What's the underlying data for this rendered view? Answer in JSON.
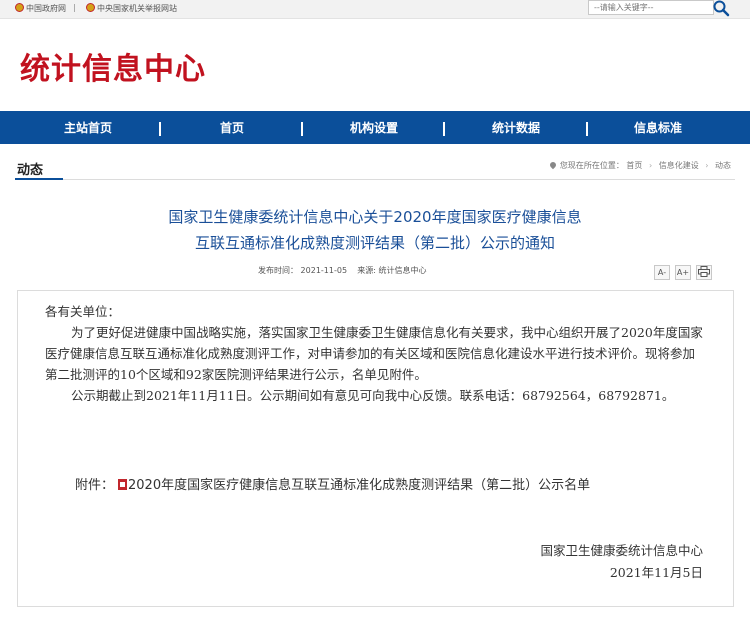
{
  "topbar": {
    "link1": "中国政府网",
    "sep": "|",
    "link2": "中央国家机关举报网站",
    "search_placeholder": "--请输入关键字--"
  },
  "site": {
    "title": "统计信息中心"
  },
  "nav": {
    "items": [
      "主站首页",
      "首页",
      "机构设置",
      "统计数据",
      "信息标准"
    ],
    "divider": "|"
  },
  "section": {
    "title": "动态"
  },
  "breadcrumb": {
    "prefix": "您现在所在位置：",
    "items": [
      "首页",
      "信息化建设",
      "动态"
    ]
  },
  "article": {
    "title_line1": "国家卫生健康委统计信息中心关于2020年度国家医疗健康信息",
    "title_line2": "互联互通标准化成熟度测评结果（第二批）公示的通知",
    "date_label": "发布时间：",
    "date": "2021-11-05",
    "source_label": "来源:",
    "source": "统计信息中心",
    "tools": {
      "font_decrease": "A-",
      "font_increase": "A+"
    },
    "salutation": "各有关单位：",
    "para1": "为了更好促进健康中国战略实施，落实国家卫生健康委卫生健康信息化有关要求，我中心组织开展了2020年度国家医疗健康信息互联互通标准化成熟度测评工作，对申请参加的有关区域和医院信息化建设水平进行技术评价。现将参加第二批测评的10个区域和92家医院测评结果进行公示，名单见附件。",
    "para2": "公示期截止到2021年11月11日。公示期间如有意见可向我中心反馈。联系电话：68792564，68792871。",
    "attachment_label": "附件：",
    "attachment_link": "2020年度国家医疗健康信息互联互通标准化成熟度测评结果（第二批）公示名单",
    "signature_org": "国家卫生健康委统计信息中心",
    "signature_date": "2021年11月5日"
  },
  "colors": {
    "brand_red": "#c1121f",
    "nav_blue": "#0b4f9a",
    "title_blue": "#1a4f98"
  },
  "icons": [
    "emblem-icon",
    "search-icon",
    "location-pin-icon",
    "print-icon",
    "pdf-icon"
  ]
}
